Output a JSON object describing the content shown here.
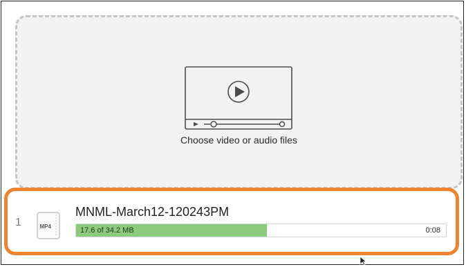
{
  "dropzone": {
    "label": "Choose video or audio files",
    "icon": "video-player-icon"
  },
  "upload": {
    "index": "1",
    "file_type": "MP4",
    "file_name": "MNML-March12-120243PM",
    "progress_text": "17.6 of 34.2 MB",
    "progress_fraction": 0.515,
    "time_remaining": "0:08"
  },
  "colors": {
    "dropzone_bg": "#f2f2f2",
    "dropzone_border": "#c4c4c4",
    "highlight": "#ee8330",
    "progress_fill": "#8cca7d"
  }
}
